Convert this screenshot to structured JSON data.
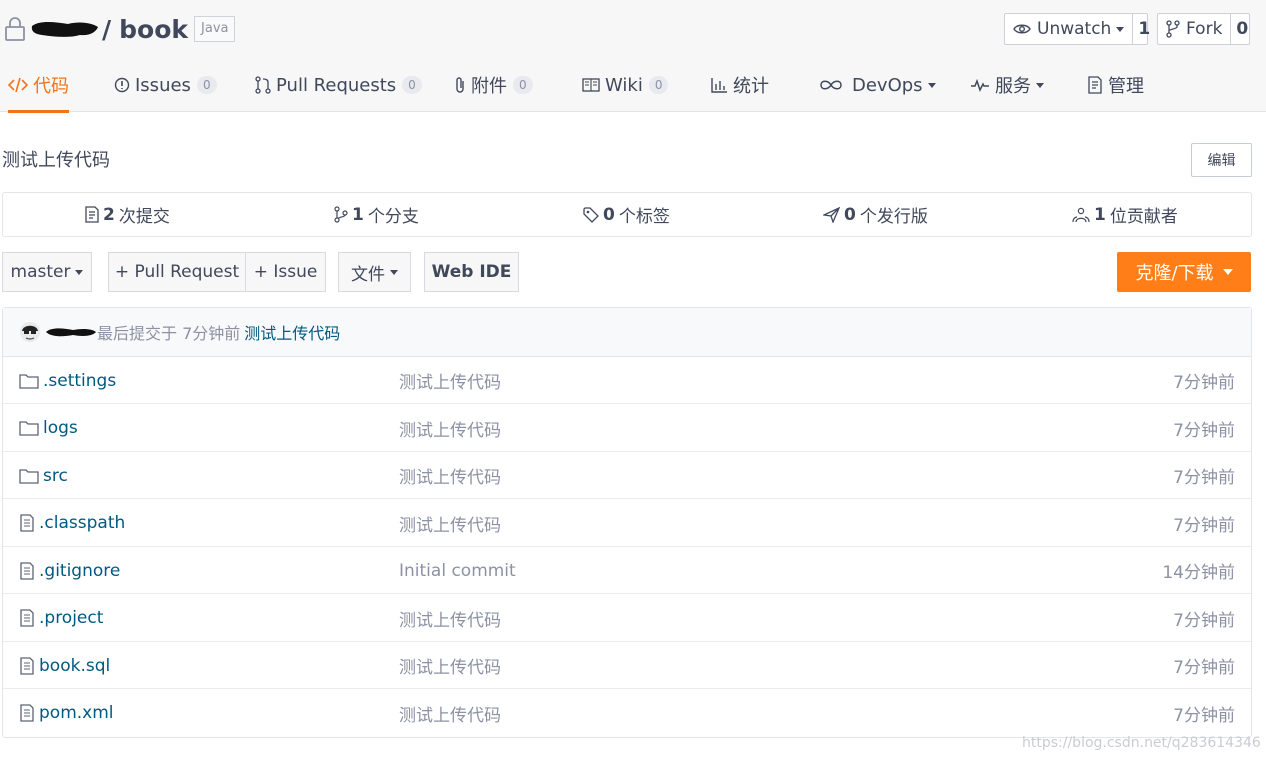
{
  "repo": {
    "name": "book",
    "language": "Java"
  },
  "header": {
    "watch_label": "Unwatch",
    "watch_count": "1",
    "fork_label": "Fork",
    "fork_count": "0"
  },
  "tabs": [
    {
      "label": "代码",
      "icon": "code-icon",
      "active": true
    },
    {
      "label": "Issues",
      "icon": "info-circle-icon",
      "badge": "0"
    },
    {
      "label": "Pull Requests",
      "icon": "pull-request-icon",
      "badge": "0"
    },
    {
      "label": "附件",
      "icon": "paperclip-icon",
      "badge": "0"
    },
    {
      "label": "Wiki",
      "icon": "book-icon",
      "badge": "0"
    },
    {
      "label": "统计",
      "icon": "bar-chart-icon"
    },
    {
      "label": "DevOps",
      "icon": "infinity-icon"
    },
    {
      "label": "服务",
      "icon": "pulse-icon"
    },
    {
      "label": "管理",
      "icon": "settings-doc-icon"
    }
  ],
  "description": "测试上传代码",
  "edit_label": "编辑",
  "stats": [
    {
      "value": "2",
      "label": "次提交",
      "icon": "commit-doc-icon"
    },
    {
      "value": "1",
      "label": "个分支",
      "icon": "branch-icon"
    },
    {
      "value": "0",
      "label": "个标签",
      "icon": "tag-icon"
    },
    {
      "value": "0",
      "label": "个发行版",
      "icon": "paper-plane-icon"
    },
    {
      "value": "1",
      "label": "位贡献者",
      "icon": "contributors-icon"
    }
  ],
  "toolbar": {
    "branch": "master",
    "new_pr": "+ Pull Request",
    "new_issue": "+ Issue",
    "file_menu": "文件",
    "web_ide": "Web IDE",
    "clone": "克隆/下载"
  },
  "last_commit": {
    "prefix": "最后提交于 7分钟前",
    "message": "测试上传代码"
  },
  "files": [
    {
      "name": ".settings",
      "type": "folder",
      "message": "测试上传代码",
      "time": "7分钟前"
    },
    {
      "name": "logs",
      "type": "folder",
      "message": "测试上传代码",
      "time": "7分钟前"
    },
    {
      "name": "src",
      "type": "folder",
      "message": "测试上传代码",
      "time": "7分钟前"
    },
    {
      "name": ".classpath",
      "type": "file",
      "message": "测试上传代码",
      "time": "7分钟前"
    },
    {
      "name": ".gitignore",
      "type": "file",
      "message": "Initial commit",
      "time": "14分钟前"
    },
    {
      "name": ".project",
      "type": "file",
      "message": "测试上传代码",
      "time": "7分钟前"
    },
    {
      "name": "book.sql",
      "type": "file",
      "message": "测试上传代码",
      "time": "7分钟前"
    },
    {
      "name": "pom.xml",
      "type": "file",
      "message": "测试上传代码",
      "time": "7分钟前"
    }
  ],
  "watermark": "https://blog.csdn.net/q283614346",
  "colors": {
    "accent": "#f0741a",
    "clone_button": "#ff7e18",
    "link": "#005980"
  }
}
